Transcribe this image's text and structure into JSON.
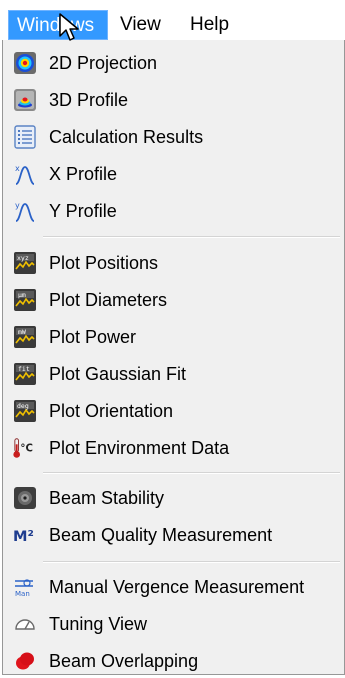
{
  "menubar": {
    "items": [
      {
        "label": "Windows"
      },
      {
        "label": "View"
      },
      {
        "label": "Help"
      }
    ]
  },
  "menu": {
    "groups": [
      [
        {
          "label": "2D Projection",
          "icon": "2d-projection-icon"
        },
        {
          "label": "3D Profile",
          "icon": "3d-profile-icon"
        },
        {
          "label": "Calculation Results",
          "icon": "calculation-results-icon"
        },
        {
          "label": "X Profile",
          "icon": "x-profile-icon",
          "icon_text": "x"
        },
        {
          "label": "Y Profile",
          "icon": "y-profile-icon",
          "icon_text": "y"
        }
      ],
      [
        {
          "label": "Plot Positions",
          "icon": "plot-positions-icon",
          "icon_text": "xyz"
        },
        {
          "label": "Plot Diameters",
          "icon": "plot-diameters-icon",
          "icon_text": "μm"
        },
        {
          "label": "Plot Power",
          "icon": "plot-power-icon",
          "icon_text": "mW"
        },
        {
          "label": "Plot Gaussian Fit",
          "icon": "plot-gaussian-fit-icon",
          "icon_text": "fit"
        },
        {
          "label": "Plot Orientation",
          "icon": "plot-orientation-icon",
          "icon_text": "deg"
        },
        {
          "label": "Plot Environment Data",
          "icon": "thermometer-icon",
          "icon_text": "°C"
        }
      ],
      [
        {
          "label": "Beam Stability",
          "icon": "beam-stability-icon"
        },
        {
          "label": "Beam Quality Measurement",
          "icon": "m-squared-icon",
          "icon_text": "M²"
        }
      ],
      [
        {
          "label": "Manual Vergence Measurement",
          "icon": "manual-vergence-icon",
          "icon_text": "Man"
        },
        {
          "label": "Tuning View",
          "icon": "tuning-gauge-icon"
        },
        {
          "label": "Beam Overlapping",
          "icon": "beam-overlapping-icon"
        }
      ]
    ]
  },
  "colors": {
    "menubar_highlight": "#3399ff",
    "menu_background": "#f0f0f0"
  }
}
